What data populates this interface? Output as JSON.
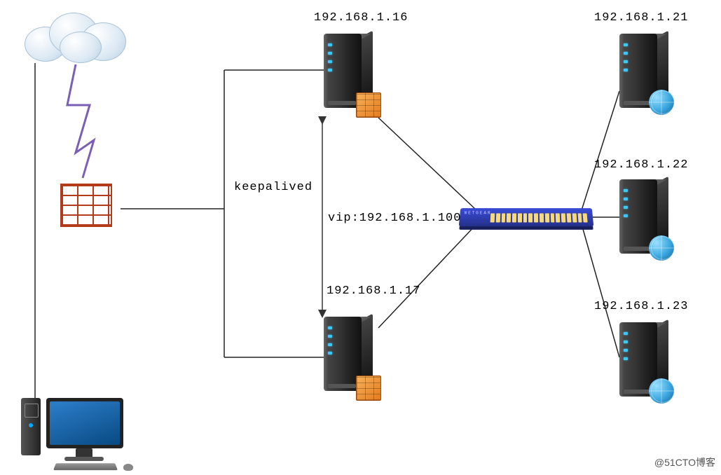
{
  "labels": {
    "srv1_ip": "192.168.1.16",
    "srv2_ip": "192.168.1.17",
    "web1_ip": "192.168.1.21",
    "web2_ip": "192.168.1.22",
    "web3_ip": "192.168.1.23",
    "keepalived": "keepalived",
    "vip": "vip:192.168.1.100"
  },
  "watermark": "@51CTO博客",
  "nodes": {
    "cloud": {
      "type": "cloud",
      "role": "internet"
    },
    "firewall": {
      "type": "firewall",
      "ip": null
    },
    "client": {
      "type": "client-pc"
    },
    "lb1": {
      "type": "server",
      "ip": "192.168.1.16",
      "overlay": "firewall",
      "role": "keepalived-master"
    },
    "lb2": {
      "type": "server",
      "ip": "192.168.1.17",
      "overlay": "firewall",
      "role": "keepalived-backup"
    },
    "switch": {
      "type": "switch",
      "vip": "192.168.1.100"
    },
    "web1": {
      "type": "server",
      "ip": "192.168.1.21",
      "overlay": "globe",
      "role": "web"
    },
    "web2": {
      "type": "server",
      "ip": "192.168.1.22",
      "overlay": "globe",
      "role": "web"
    },
    "web3": {
      "type": "server",
      "ip": "192.168.1.23",
      "overlay": "globe",
      "role": "web"
    }
  },
  "edges": [
    [
      "cloud",
      "firewall",
      "lightning"
    ],
    [
      "firewall",
      "lb1",
      "hv"
    ],
    [
      "firewall",
      "lb2",
      "hv"
    ],
    [
      "cloud",
      "client",
      "v"
    ],
    [
      "lb1",
      "lb2",
      "keepalived-arrow"
    ],
    [
      "lb1",
      "switch",
      "line"
    ],
    [
      "lb2",
      "switch",
      "line"
    ],
    [
      "switch",
      "web1",
      "line"
    ],
    [
      "switch",
      "web2",
      "line"
    ],
    [
      "switch",
      "web3",
      "line"
    ]
  ]
}
